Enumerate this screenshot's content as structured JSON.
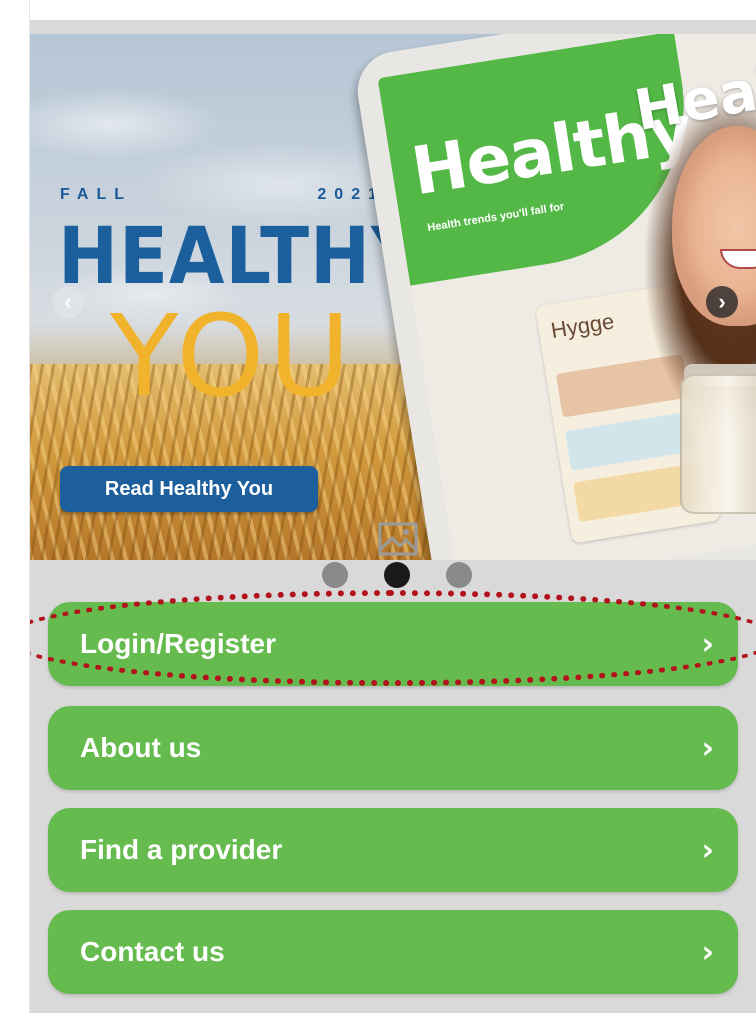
{
  "banner": {
    "season": [
      "FALL",
      "2021"
    ],
    "headline_line1": "HEALTHY",
    "headline_line2": "YOU",
    "read_button_label": "Read Healthy You",
    "magazine_title": "Healthy",
    "magazine_subtitle": "Health trends you'll fall for",
    "magazine_card_heading": "Hygge",
    "overlay_title": "Healthy You",
    "prev_icon": "chevron-left-icon",
    "next_icon": "chevron-right-icon",
    "prev_glyph": "‹",
    "next_glyph": "›",
    "placeholder_icon": "image-placeholder-icon"
  },
  "carousel": {
    "dots": 3,
    "active_index": 1
  },
  "menu": {
    "items": [
      {
        "label": "Login/Register",
        "chevron": "›",
        "highlighted": true
      },
      {
        "label": "About us",
        "chevron": "›"
      },
      {
        "label": "Find a provider",
        "chevron": "›"
      },
      {
        "label": "Contact us",
        "chevron": "›"
      }
    ]
  },
  "colors": {
    "menu_green": "#66bb4e",
    "brand_blue": "#1b5f9c",
    "brand_yellow": "#f1b32b",
    "highlight_red": "#b1121b",
    "background_gray": "#d9d9d9"
  }
}
